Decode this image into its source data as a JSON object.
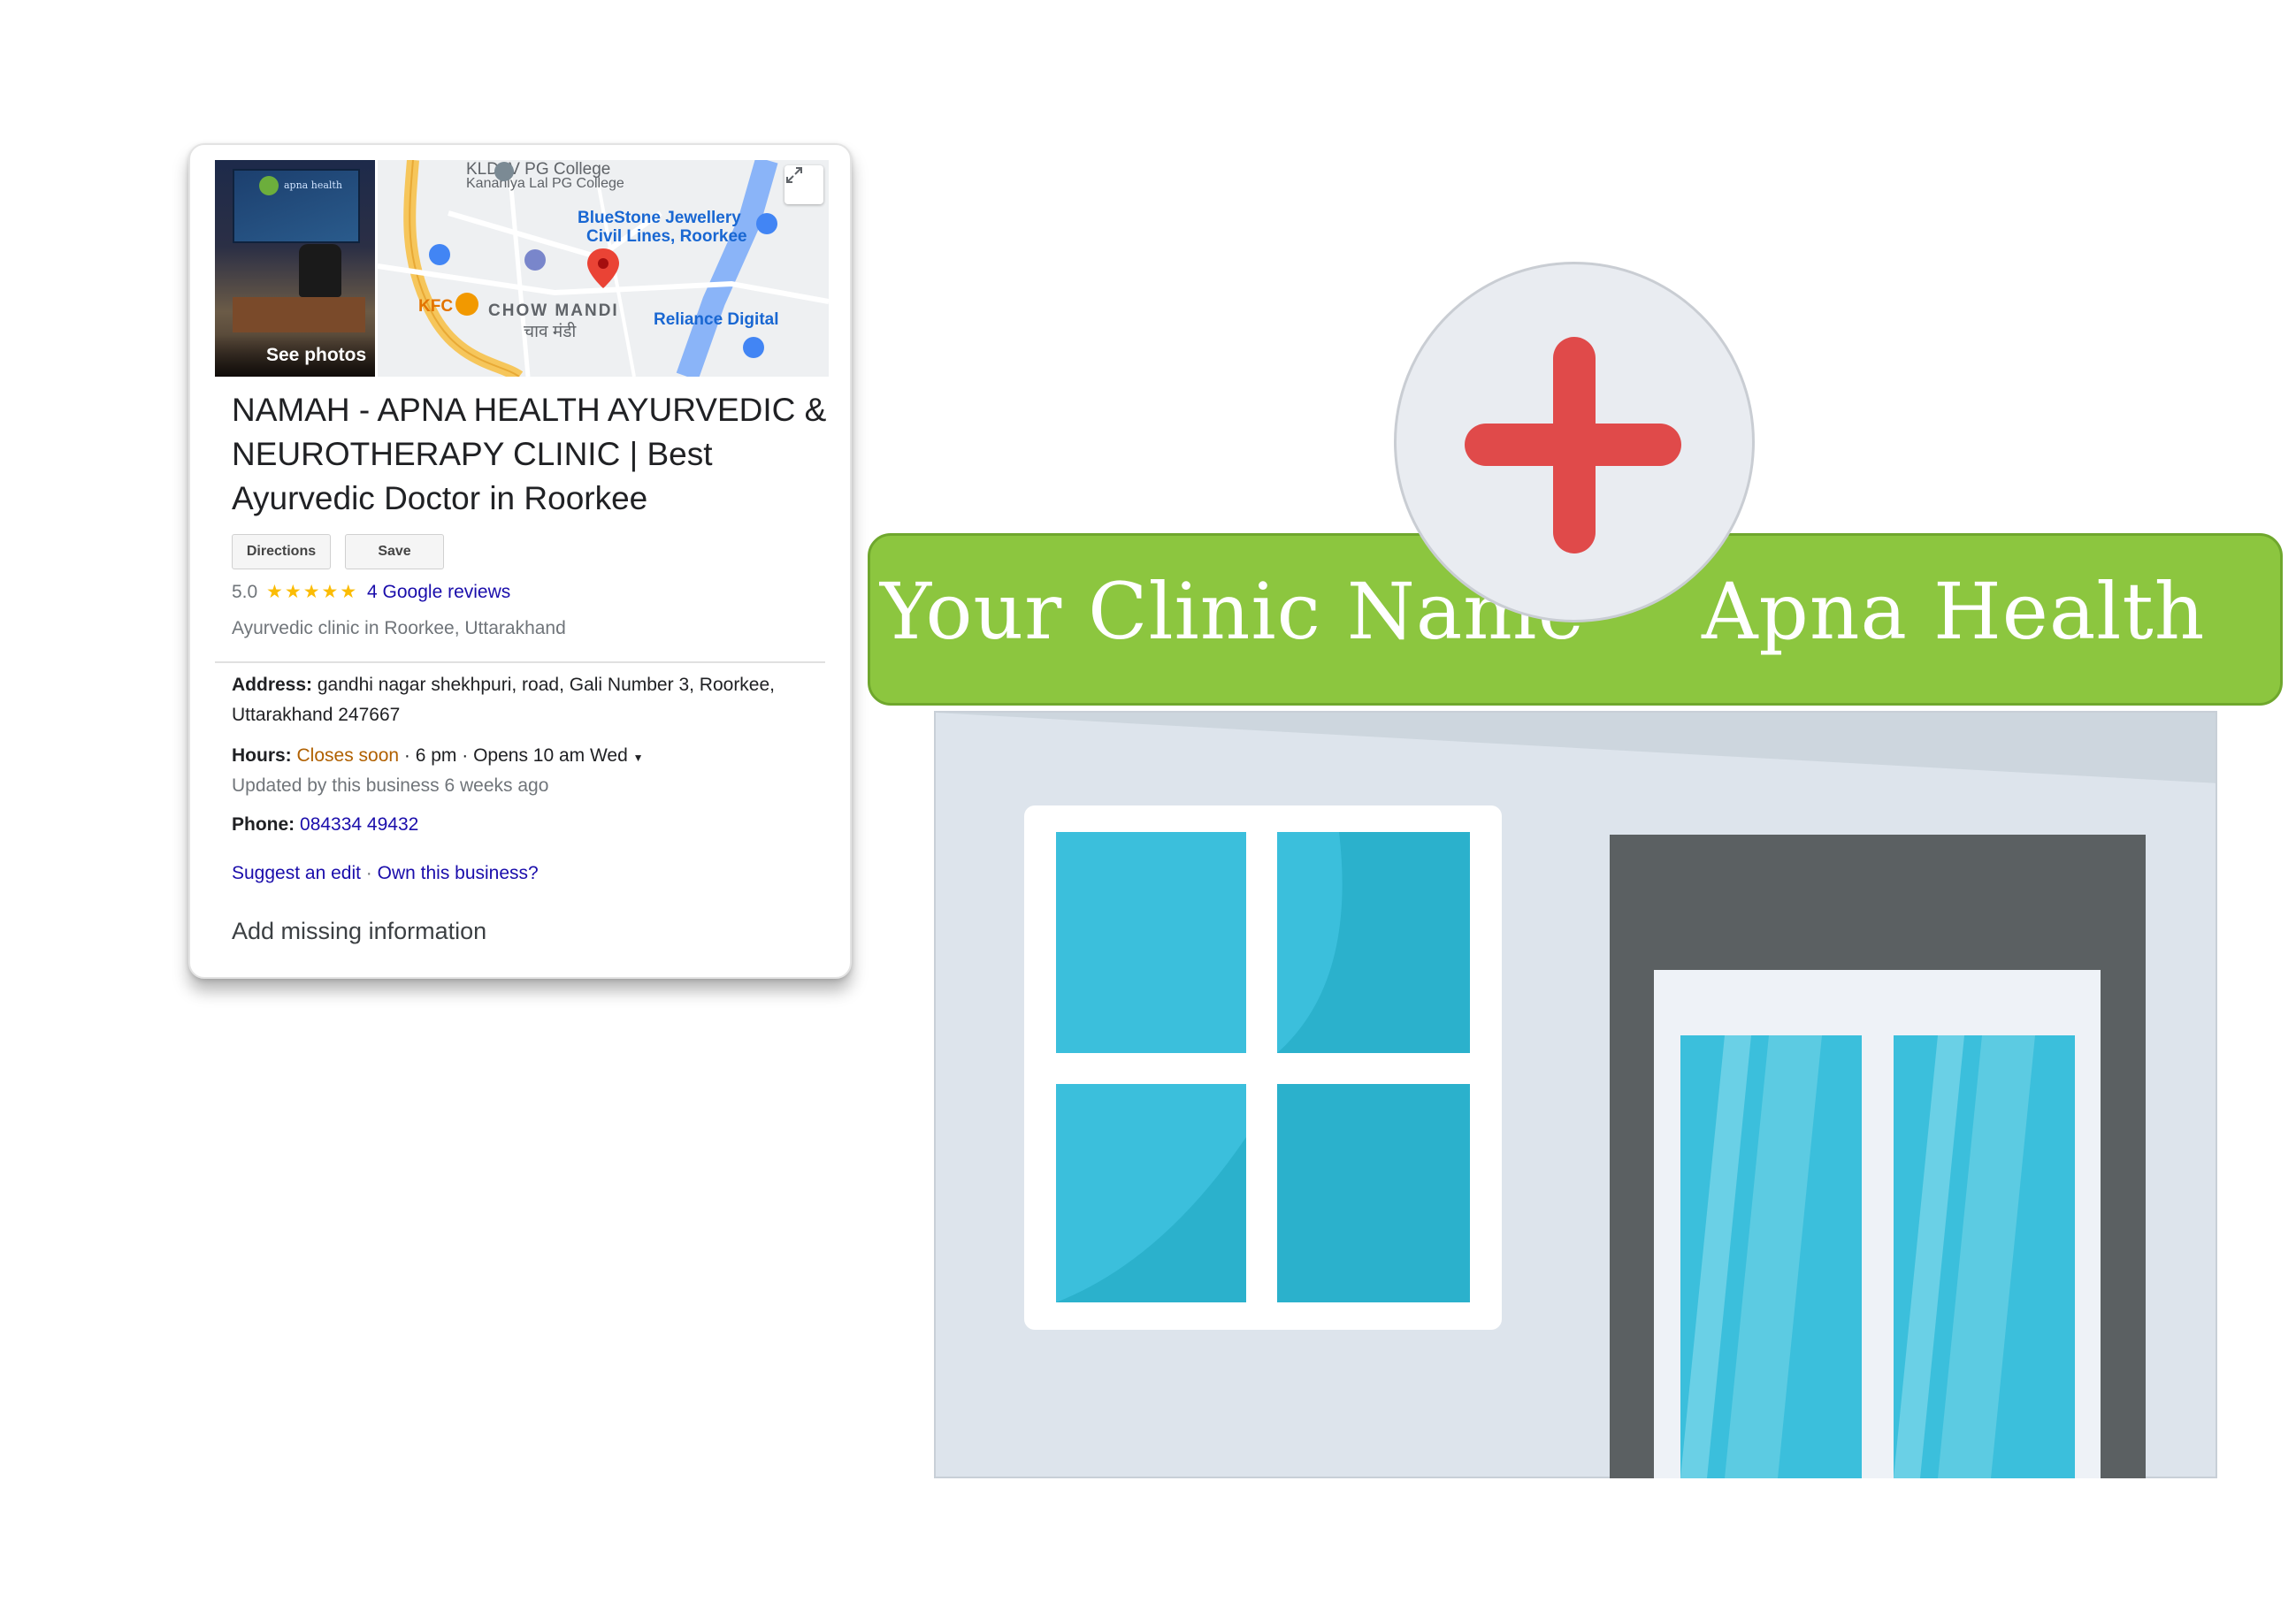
{
  "panel": {
    "photo_label": "See photos",
    "photo_sign_text": "apna health",
    "map_labels": {
      "college": "KLDAV PG College",
      "college_sub": "Kanahiya Lal PG College",
      "jeweller_1": "BlueStone Jewellery",
      "jeweller_2": "Civil Lines, Roorkee",
      "kfc": "KFC",
      "chow_mandi": "CHOW MANDI",
      "chow_mandi_hindi": "चाव मंडी",
      "reliance": "Reliance Digital"
    },
    "title": "NAMAH - APNA HEALTH AYURVEDIC & NEUROTHERAPY CLINIC | Best Ayurvedic Doctor in Roorkee",
    "buttons": {
      "directions": "Directions",
      "save": "Save"
    },
    "rating": "5.0",
    "stars": "★★★★★",
    "reviews": "4 Google reviews",
    "category": "Ayurvedic clinic in Roorkee, Uttarakhand",
    "address_label": "Address:",
    "address_value": "gandhi nagar shekhpuri, road, Gali Number 3, Roorkee, Uttarakhand 247667",
    "hours_label": "Hours:",
    "hours_status": "Closes soon",
    "hours_detail": " · 6 pm · Opens 10 am Wed",
    "hours_updated": "Updated by this business 6 weeks ago",
    "phone_label": "Phone:",
    "phone_value": "084334 49432",
    "suggest_edit": "Suggest an edit",
    "separator": " · ",
    "own_business": "Own this business?",
    "add_missing": "Add missing information"
  },
  "sign": {
    "left_text": "Your Clinic Name",
    "right_text": "Apna Health"
  },
  "colors": {
    "sign_green": "#8cc63f",
    "cross_red": "#e04a4a",
    "glass_blue": "#3bbfdc",
    "link_blue": "#1a0dab",
    "star_yellow": "#fbbc04"
  }
}
